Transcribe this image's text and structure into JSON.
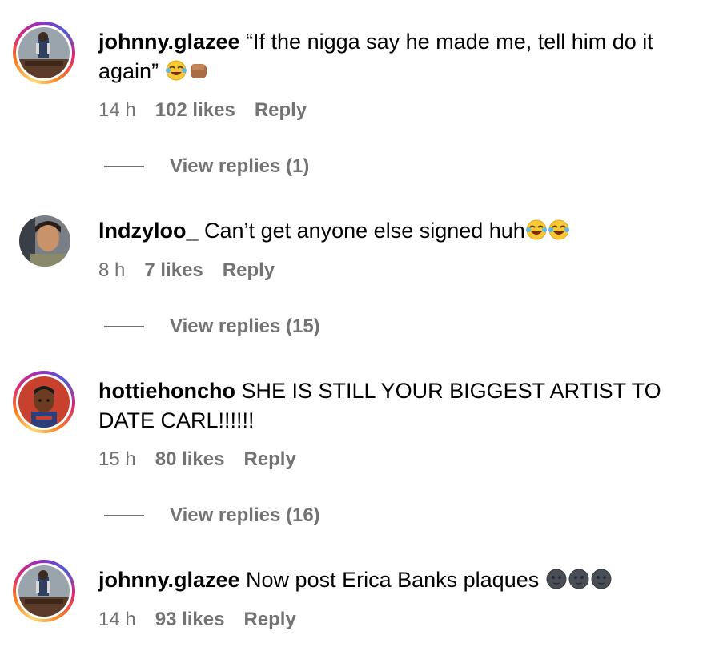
{
  "comments": [
    {
      "username": "johnny.glazee",
      "text": "“If the nigga say he made me, tell him do it again”",
      "emojis": [
        "face-with-tears-of-joy-emoji",
        "fist-bump-emoji"
      ],
      "time": "14 h",
      "likes": "102 likes",
      "reply": "Reply",
      "view_replies": "View replies (1)"
    },
    {
      "username": "lndzyloo_",
      "text": "Can’t get anyone else signed huh",
      "emojis": [
        "face-with-tears-of-joy-emoji",
        "face-with-tears-of-joy-emoji"
      ],
      "time": "8 h",
      "likes": "7 likes",
      "reply": "Reply",
      "view_replies": "View replies (15)"
    },
    {
      "username": "hottiehoncho",
      "text": "SHE IS STILL YOUR BIGGEST ARTIST TO DATE CARL!!!!!!",
      "time": "15 h",
      "likes": "80 likes",
      "reply": "Reply",
      "view_replies": "View replies (16)"
    },
    {
      "username": "johnny.glazee",
      "text": "Now post Erica Banks plaques",
      "emojis": [
        "new-moon-face-emoji",
        "new-moon-face-emoji",
        "new-moon-face-emoji"
      ],
      "time": "14 h",
      "likes": "93 likes",
      "reply": "Reply"
    }
  ],
  "colors": {
    "meta_text": "#737373",
    "story_ring": [
      "#feda75",
      "#fa7e1e",
      "#d62976",
      "#962fbf",
      "#4f5bd5"
    ]
  }
}
